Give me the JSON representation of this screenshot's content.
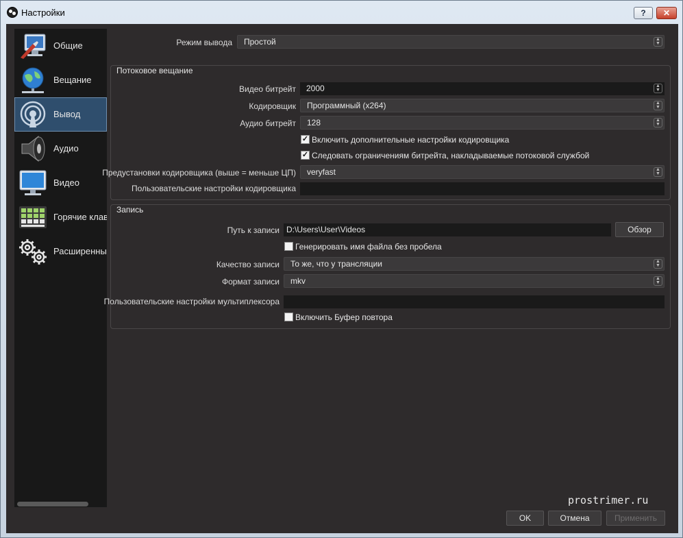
{
  "window": {
    "title": "Настройки",
    "help_label": "?",
    "close_label": "✕"
  },
  "sidebar": {
    "items": [
      {
        "label": "Общие",
        "icon": "general-monitor-icon"
      },
      {
        "label": "Вещание",
        "icon": "globe-network-icon"
      },
      {
        "label": "Вывод",
        "icon": "broadcast-antenna-icon",
        "active": true
      },
      {
        "label": "Аудио",
        "icon": "speaker-icon"
      },
      {
        "label": "Видео",
        "icon": "monitor-icon"
      },
      {
        "label": "Горячие клави",
        "icon": "keyboard-icon"
      },
      {
        "label": "Расширенные",
        "icon": "gears-icon"
      }
    ]
  },
  "output_mode": {
    "label": "Режим вывода",
    "value": "Простой"
  },
  "streaming": {
    "title": "Потоковое вещание",
    "video_bitrate": {
      "label": "Видео битрейт",
      "value": "2000"
    },
    "encoder": {
      "label": "Кодировщик",
      "value": "Программный (x264)"
    },
    "audio_bitrate": {
      "label": "Аудио битрейт",
      "value": "128"
    },
    "advanced_encoder": {
      "label": "Включить дополнительные настройки кодировщика",
      "checked": true
    },
    "enforce_limits": {
      "label": "Следовать ограничениям битрейта, накладываемые потоковой службой",
      "checked": true
    },
    "preset": {
      "label": "Предустановки кодировщика (выше = меньше ЦП)",
      "value": "veryfast"
    },
    "custom_settings": {
      "label": "Пользовательские настройки кодировщика",
      "value": ""
    }
  },
  "recording": {
    "title": "Запись",
    "path": {
      "label": "Путь к записи",
      "value": "D:\\Users\\User\\Videos"
    },
    "browse_label": "Обзор",
    "no_space": {
      "label": "Генерировать имя файла без пробела",
      "checked": false
    },
    "quality": {
      "label": "Качество записи",
      "value": "То же, что у трансляции"
    },
    "format": {
      "label": "Формат записи",
      "value": "mkv"
    },
    "muxer": {
      "label": "Пользовательские настройки мультиплексора",
      "value": ""
    },
    "replay_buffer": {
      "label": "Включить Буфер повтора",
      "checked": false
    }
  },
  "watermark": "prostrimer.ru",
  "buttons": {
    "ok": "OK",
    "cancel": "Отмена",
    "apply": "Применить"
  }
}
